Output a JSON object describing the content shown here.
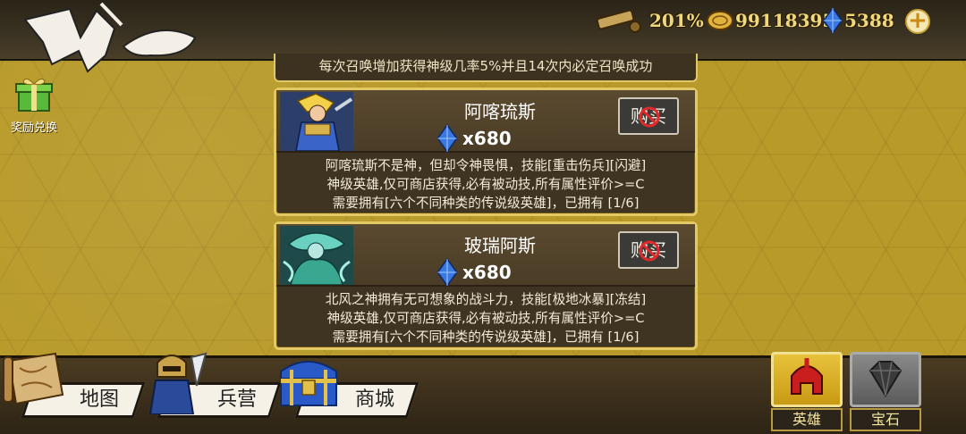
{
  "header": {
    "spyglass_value": "201%",
    "gold_value": "99118395",
    "gem_value": "5388",
    "plus_label": "+"
  },
  "sidebar": {
    "reward_label": "奖励兑换"
  },
  "shop": {
    "prev_desc": "每次召唤增加获得神级几率5%并且14次内必定召唤成功",
    "items": [
      {
        "name": "阿喀琉斯",
        "price": "x680",
        "buy_label": "购买",
        "desc_line1": "阿喀琉斯不是神，但却令神畏惧，技能[重击伤兵][闪避]",
        "desc_line2": "神级英雄,仅可商店获得,必有被动技,所有属性评价>=C",
        "desc_line3": "需要拥有[六个不同种类的传说级英雄]，已拥有 [1/6]"
      },
      {
        "name": "玻瑞阿斯",
        "price": "x680",
        "buy_label": "购买",
        "desc_line1": "北风之神拥有无可想象的战斗力，技能[极地冰暴][冻结]",
        "desc_line2": "神级英雄,仅可商店获得,必有被动技,所有属性评价>=C",
        "desc_line3": "需要拥有[六个不同种类的传说级英雄]，已拥有 [1/6]"
      }
    ]
  },
  "nav": {
    "tabs": [
      {
        "label": "地图",
        "icon": "map-scroll-icon"
      },
      {
        "label": "兵营",
        "icon": "knight-icon"
      },
      {
        "label": "商城",
        "icon": "treasure-chest-icon"
      }
    ],
    "side": [
      {
        "label": "英雄",
        "icon": "helmet-icon",
        "active": true
      },
      {
        "label": "宝石",
        "icon": "diamond-icon",
        "active": false
      }
    ]
  },
  "colors": {
    "gold_bg": "#b89a2a",
    "card_border": "#e3c963",
    "card_bg": "#3f3322"
  }
}
